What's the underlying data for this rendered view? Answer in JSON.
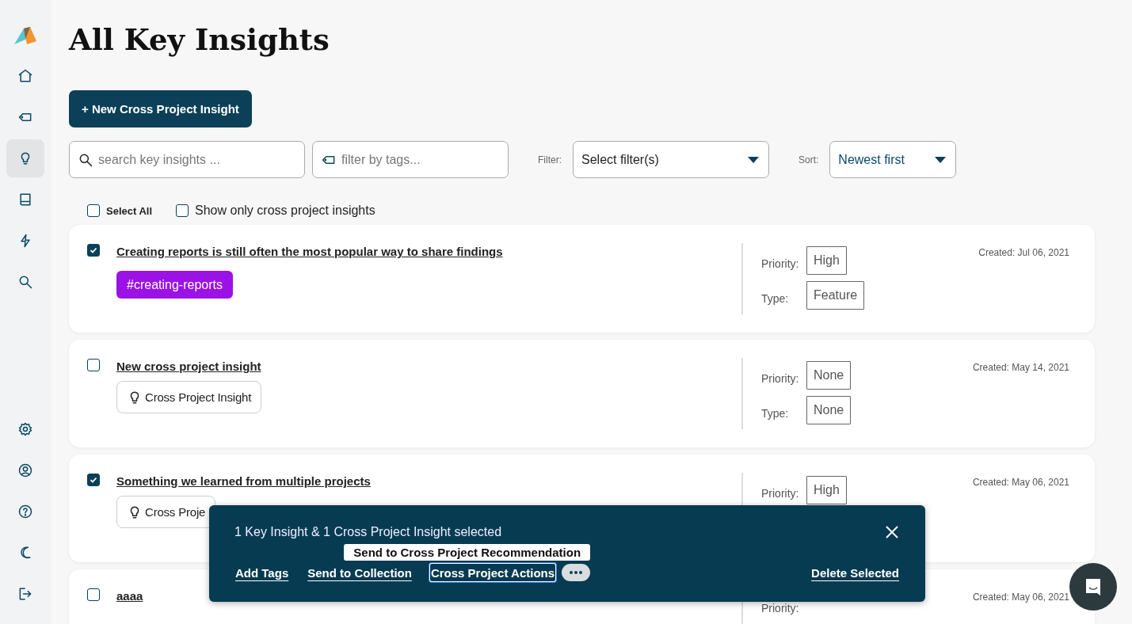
{
  "sidebar": {
    "nav": [
      {
        "kind": "home",
        "selected": false
      },
      {
        "kind": "tag",
        "selected": false
      },
      {
        "kind": "bulb",
        "selected": true
      },
      {
        "kind": "book",
        "selected": false
      },
      {
        "kind": "bolt",
        "selected": false
      },
      {
        "kind": "search",
        "selected": false
      }
    ],
    "bottom": [
      {
        "kind": "gear"
      },
      {
        "kind": "user"
      },
      {
        "kind": "help"
      },
      {
        "kind": "moon"
      },
      {
        "kind": "logout"
      }
    ]
  },
  "title": "All Key Insights",
  "new_button": "+ New Cross Project Insight",
  "search": {
    "placeholder": "search key insights ..."
  },
  "tag_filter": {
    "placeholder": "filter by tags..."
  },
  "filter": {
    "label": "Filter:",
    "value": "Select filter(s)"
  },
  "sort": {
    "label": "Sort:",
    "value": "Newest first"
  },
  "select_all": {
    "label": "Select All",
    "checked": false
  },
  "cross_only": {
    "label": "Show only cross project insights",
    "checked": false
  },
  "cards": [
    {
      "checked": true,
      "title": "Creating reports is still often the most popular way to share findings",
      "tags": [
        {
          "kind": "hashtag",
          "label": "#creating-reports",
          "color": "#9b12e6"
        }
      ],
      "fields": [
        {
          "label": "Priority:",
          "value": "High"
        },
        {
          "label": "Type:",
          "value": "Feature"
        }
      ],
      "created": "Created: Jul 06, 2021"
    },
    {
      "checked": false,
      "title": "New cross project insight",
      "tags": [
        {
          "kind": "insight",
          "label": "Cross Project Insight"
        }
      ],
      "fields": [
        {
          "label": "Priority:",
          "value": "None"
        },
        {
          "label": "Type:",
          "value": "None"
        }
      ],
      "created": "Created: May 14, 2021"
    },
    {
      "checked": true,
      "title": "Something we learned from multiple projects",
      "tags": [
        {
          "kind": "insight",
          "label": "Cross Proje"
        }
      ],
      "fields": [
        {
          "label": "Priority:",
          "value": "High"
        }
      ],
      "created": "Created: May 06, 2021"
    },
    {
      "checked": false,
      "title": "aaaa",
      "fields": [
        {
          "label": "Priority:"
        }
      ],
      "created": "Created: May 06, 2021"
    }
  ],
  "selection_bar": {
    "message": "1 Key Insight & 1 Cross Project Insight selected",
    "tooltip": "Send to Cross Project Recommendation",
    "actions": [
      {
        "label": "Add Tags",
        "focused": false
      },
      {
        "label": "Send to Collection",
        "focused": false
      },
      {
        "label": "Cross Project Actions",
        "focused": true
      }
    ],
    "delete": "Delete Selected"
  }
}
